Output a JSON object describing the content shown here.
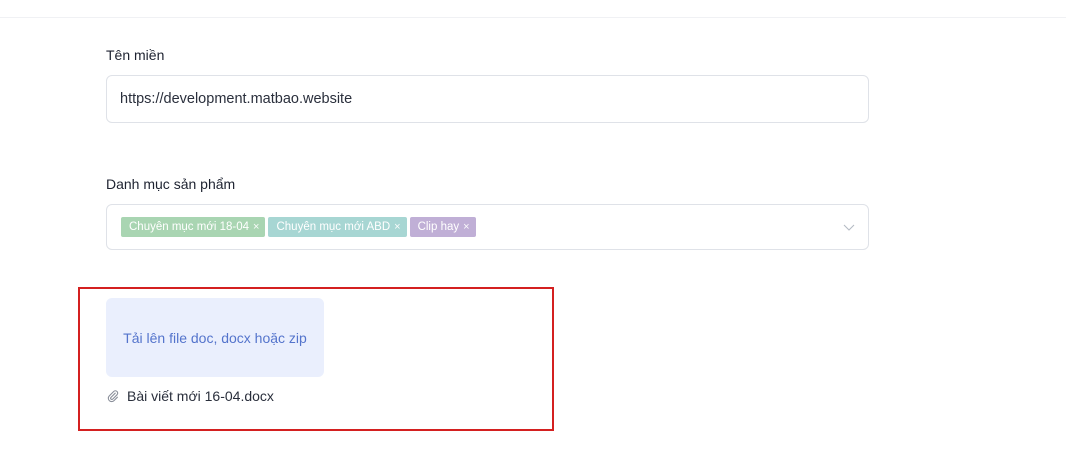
{
  "domain_field": {
    "label": "Tên miền",
    "value": "https://development.matbao.website"
  },
  "category_field": {
    "label": "Danh mục sản phẩm",
    "tags": [
      {
        "label": "Chuyên mục mới 18-04",
        "color": "#a9d5b2"
      },
      {
        "label": "Chuyên mục mới ABD",
        "color": "#a7d6d3"
      },
      {
        "label": "Clip hay",
        "color": "#c0afd6"
      }
    ],
    "remove_glyph": "×"
  },
  "upload": {
    "button_label": "Tải lên file doc, docx hoặc zip",
    "file_name": "Bài viết mới 16-04.docx"
  },
  "colors": {
    "highlight_border": "#d42020",
    "upload_bg": "#eaeffd",
    "upload_text": "#5474cc"
  },
  "icons": {
    "chevron": "chevron-down-icon",
    "attachment": "paperclip-icon"
  }
}
